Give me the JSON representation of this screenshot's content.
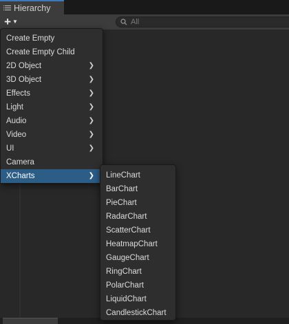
{
  "window": {
    "tab_title": "Hierarchy"
  },
  "toolbar": {
    "add_icon": "plus-icon",
    "search_placeholder": "All"
  },
  "context_menu": {
    "items": [
      {
        "label": "Create Empty",
        "has_submenu": false
      },
      {
        "label": "Create Empty Child",
        "has_submenu": false
      },
      {
        "label": "2D Object",
        "has_submenu": true
      },
      {
        "label": "3D Object",
        "has_submenu": true
      },
      {
        "label": "Effects",
        "has_submenu": true
      },
      {
        "label": "Light",
        "has_submenu": true
      },
      {
        "label": "Audio",
        "has_submenu": true
      },
      {
        "label": "Video",
        "has_submenu": true
      },
      {
        "label": "UI",
        "has_submenu": true
      },
      {
        "label": "Camera",
        "has_submenu": false
      },
      {
        "label": "XCharts",
        "has_submenu": true,
        "highlighted": true
      }
    ]
  },
  "submenu": {
    "parent": "XCharts",
    "items": [
      {
        "label": "LineChart"
      },
      {
        "label": "BarChart"
      },
      {
        "label": "PieChart"
      },
      {
        "label": "RadarChart"
      },
      {
        "label": "ScatterChart"
      },
      {
        "label": "HeatmapChart"
      },
      {
        "label": "GaugeChart"
      },
      {
        "label": "RingChart"
      },
      {
        "label": "PolarChart"
      },
      {
        "label": "LiquidChart"
      },
      {
        "label": "CandlestickChart"
      }
    ]
  },
  "colors": {
    "highlight": "#2c5d87",
    "menu_background": "#2e2e2e",
    "panel_background": "#282828",
    "tab_accent": "#3a79bb"
  }
}
